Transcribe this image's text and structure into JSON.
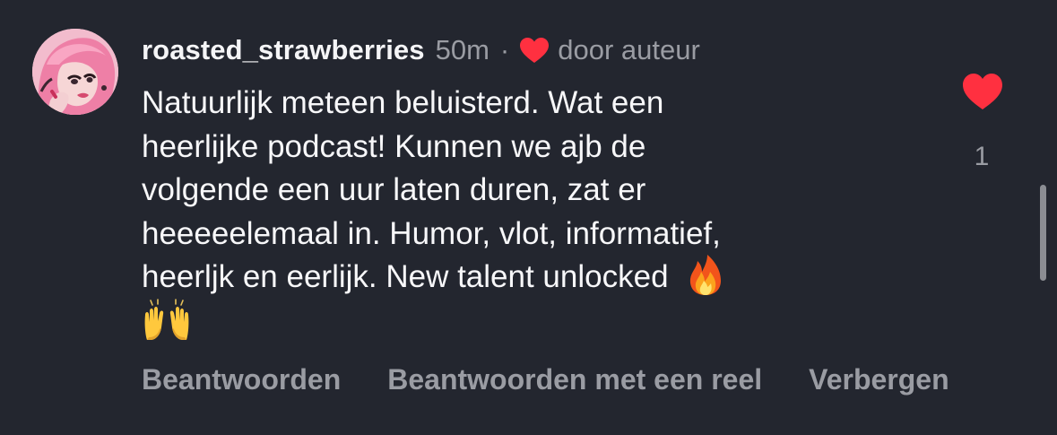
{
  "comment": {
    "username": "roasted_strawberries",
    "time": "50m",
    "separator": "·",
    "author_liked_label": "door auteur",
    "text_lines": [
      "Natuurlijk meteen beluisterd. Wat een",
      "heerlijke podcast! Kunnen we ajb de",
      "volgende een uur laten duren, zat er",
      "heeeeelemaal in. Humor, vlot, informatief,",
      "heerljk en eerlijk. New talent unlocked"
    ],
    "emojis": [
      "fire",
      "raising-hands"
    ],
    "like_count": "1",
    "liked": true,
    "accent_color": "#ff3040"
  },
  "actions": {
    "reply_label": "Beantwoorden",
    "reply_reel_label": "Beantwoorden met een reel",
    "hide_label": "Verbergen"
  }
}
